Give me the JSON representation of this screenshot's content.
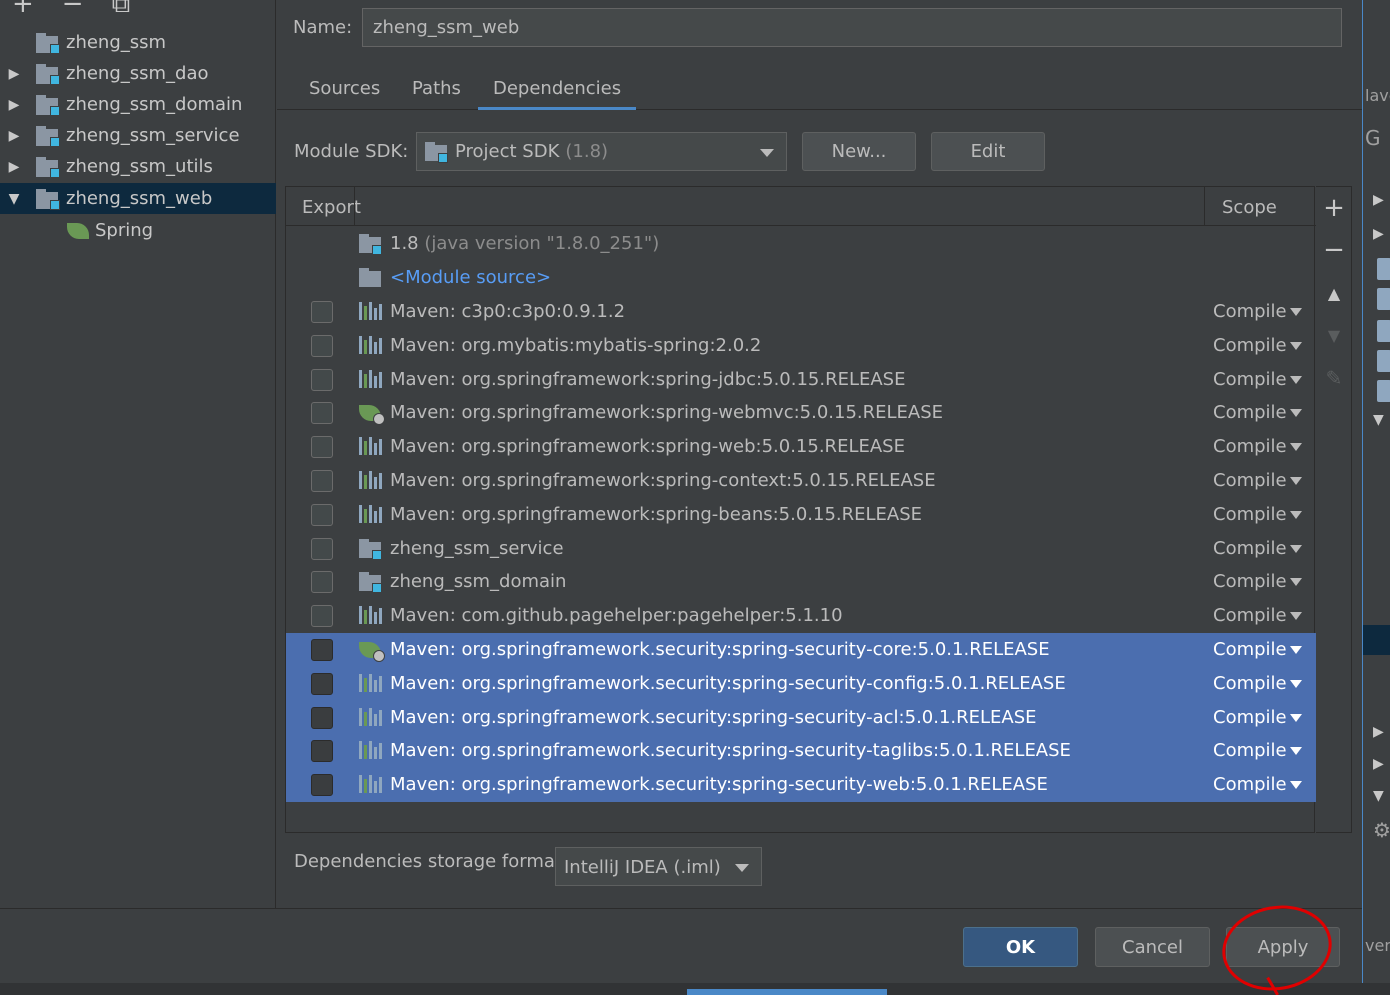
{
  "tree": {
    "toolbar": [
      "+",
      "−",
      "⧉"
    ],
    "items": [
      {
        "label": "zheng_ssm",
        "arrow": ""
      },
      {
        "label": "zheng_ssm_dao",
        "arrow": "▶"
      },
      {
        "label": "zheng_ssm_domain",
        "arrow": "▶"
      },
      {
        "label": "zheng_ssm_service",
        "arrow": "▶"
      },
      {
        "label": "zheng_ssm_utils",
        "arrow": "▶"
      },
      {
        "label": "zheng_ssm_web",
        "arrow": "▼"
      },
      {
        "label": "Spring",
        "arrow": ""
      }
    ]
  },
  "name": {
    "label": "Name:",
    "value": "zheng_ssm_web"
  },
  "tabs": [
    "Sources",
    "Paths",
    "Dependencies"
  ],
  "sdk": {
    "label": "Module SDK:",
    "value": "Project SDK",
    "version": "(1.8)",
    "new_label": "New...",
    "edit_label": "Edit"
  },
  "table": {
    "headers": {
      "export": "Export",
      "scope": "Scope"
    },
    "sdk_row": {
      "text": "1.8",
      "dim": "(java version \"1.8.0_251\")"
    },
    "module_source": "<Module source>",
    "rows": [
      {
        "text": "Maven: c3p0:c3p0:0.9.1.2",
        "scope": "Compile",
        "icon": "maven-library-icon"
      },
      {
        "text": "Maven: org.mybatis:mybatis-spring:2.0.2",
        "scope": "Compile",
        "icon": "maven-library-icon"
      },
      {
        "text": "Maven: org.springframework:spring-jdbc:5.0.15.RELEASE",
        "scope": "Compile",
        "icon": "maven-library-icon"
      },
      {
        "text": "Maven: org.springframework:spring-webmvc:5.0.15.RELEASE",
        "scope": "Compile",
        "icon": "spring-web-icon"
      },
      {
        "text": "Maven: org.springframework:spring-web:5.0.15.RELEASE",
        "scope": "Compile",
        "icon": "maven-library-icon"
      },
      {
        "text": "Maven: org.springframework:spring-context:5.0.15.RELEASE",
        "scope": "Compile",
        "icon": "maven-library-icon"
      },
      {
        "text": "Maven: org.springframework:spring-beans:5.0.15.RELEASE",
        "scope": "Compile",
        "icon": "maven-library-icon"
      },
      {
        "text": "zheng_ssm_service",
        "scope": "Compile",
        "icon": "module-folder-icon"
      },
      {
        "text": "zheng_ssm_domain",
        "scope": "Compile",
        "icon": "module-folder-icon"
      },
      {
        "text": "Maven: com.github.pagehelper:pagehelper:5.1.10",
        "scope": "Compile",
        "icon": "maven-library-icon"
      },
      {
        "text": "Maven: org.springframework.security:spring-security-core:5.0.1.RELEASE",
        "scope": "Compile",
        "icon": "spring-security-icon",
        "selected": true
      },
      {
        "text": "Maven: org.springframework.security:spring-security-config:5.0.1.RELEASE",
        "scope": "Compile",
        "icon": "maven-library-icon",
        "selected": true
      },
      {
        "text": "Maven: org.springframework.security:spring-security-acl:5.0.1.RELEASE",
        "scope": "Compile",
        "icon": "maven-library-icon",
        "selected": true
      },
      {
        "text": "Maven: org.springframework.security:spring-security-taglibs:5.0.1.RELEASE",
        "scope": "Compile",
        "icon": "maven-library-icon",
        "selected": true
      },
      {
        "text": "Maven: org.springframework.security:spring-security-web:5.0.1.RELEASE",
        "scope": "Compile",
        "icon": "maven-library-icon",
        "selected": true
      }
    ]
  },
  "side_tools": [
    "+",
    "−",
    "▲",
    "▼",
    "✎"
  ],
  "storage": {
    "label": "Dependencies storage format:",
    "value": "IntelliJ IDEA (.iml)"
  },
  "buttons": {
    "ok": "OK",
    "cancel": "Cancel",
    "apply": "Apply"
  },
  "background": {
    "right_top": "lave",
    "right_g": "G",
    "right_bottom": "ven"
  },
  "colors": {
    "selection": "#4b6eaf",
    "tree_selection": "#0d293e",
    "accent": "#4a88c7",
    "annotation": "#e00000"
  }
}
